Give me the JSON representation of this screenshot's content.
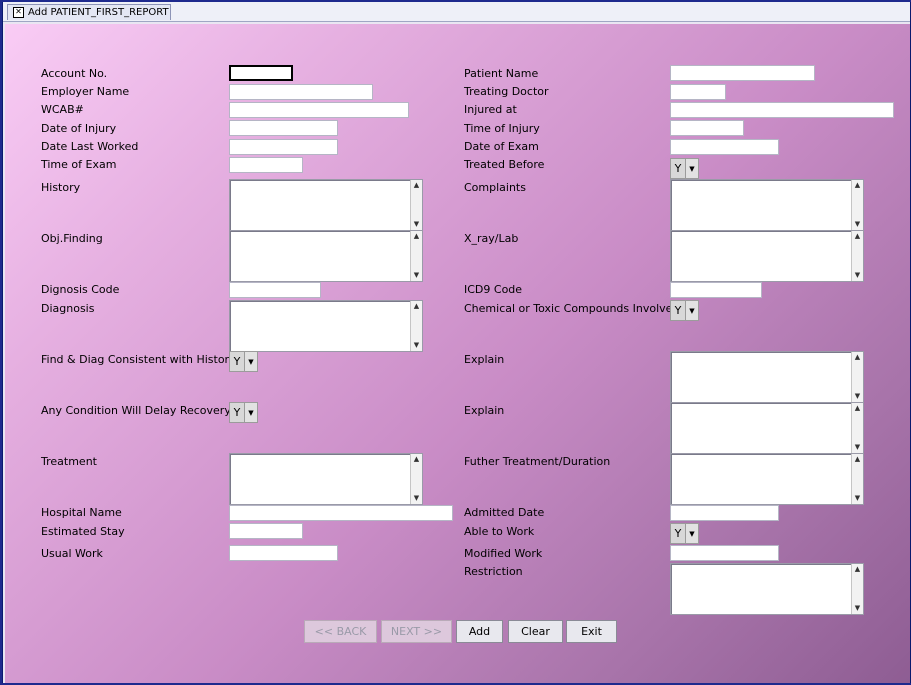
{
  "window": {
    "tab_title": "Add PATIENT_FIRST_REPORT",
    "close_glyph": "✕"
  },
  "form": {
    "labels": {
      "account_no": "Account No.",
      "patient_name": "Patient Name",
      "employer_name": "Employer Name",
      "treating_doctor": "Treating Doctor",
      "wcab": "WCAB#",
      "injured_at": "Injured at",
      "date_of_injury": "Date of Injury",
      "time_of_injury": "Time of Injury",
      "date_last_worked": "Date Last Worked",
      "date_of_exam": "Date of Exam",
      "time_of_exam": "Time of Exam",
      "treated_before": "Treated Before",
      "history": "History",
      "complaints": "Complaints",
      "obj_finding": "Obj.Finding",
      "xray_lab": "X_ray/Lab",
      "dignosis_code": "Dignosis Code",
      "icd9_code": "ICD9 Code",
      "diagnosis": "Diagnosis",
      "chemical": "Chemical or Toxic Compounds Involved",
      "find_diag": "Find & Diag Consistent with History",
      "explain1": "Explain",
      "delay_recovery": "Any Condition Will Delay Recovery?",
      "explain2": "Explain",
      "treatment": "Treatment",
      "further_treatment": "Futher Treatment/Duration",
      "hospital_name": "Hospital Name",
      "admitted_date": "Admitted Date",
      "estimated_stay": "Estimated Stay",
      "able_to_work": "Able to Work",
      "usual_work": "Usual Work",
      "modified_work": "Modified Work",
      "restriction": "Restriction"
    },
    "selects": {
      "treated_before": "Y",
      "chemical": "Y",
      "find_diag": "Y",
      "delay_recovery": "Y",
      "able_to_work": "Y"
    }
  },
  "buttons": {
    "back": "<< BACK",
    "next": "NEXT >>",
    "add": "Add",
    "clear": "Clear",
    "exit": "Exit"
  },
  "icons": {
    "scroll_up": "▲",
    "scroll_down": "▼",
    "dropdown": "▼"
  }
}
